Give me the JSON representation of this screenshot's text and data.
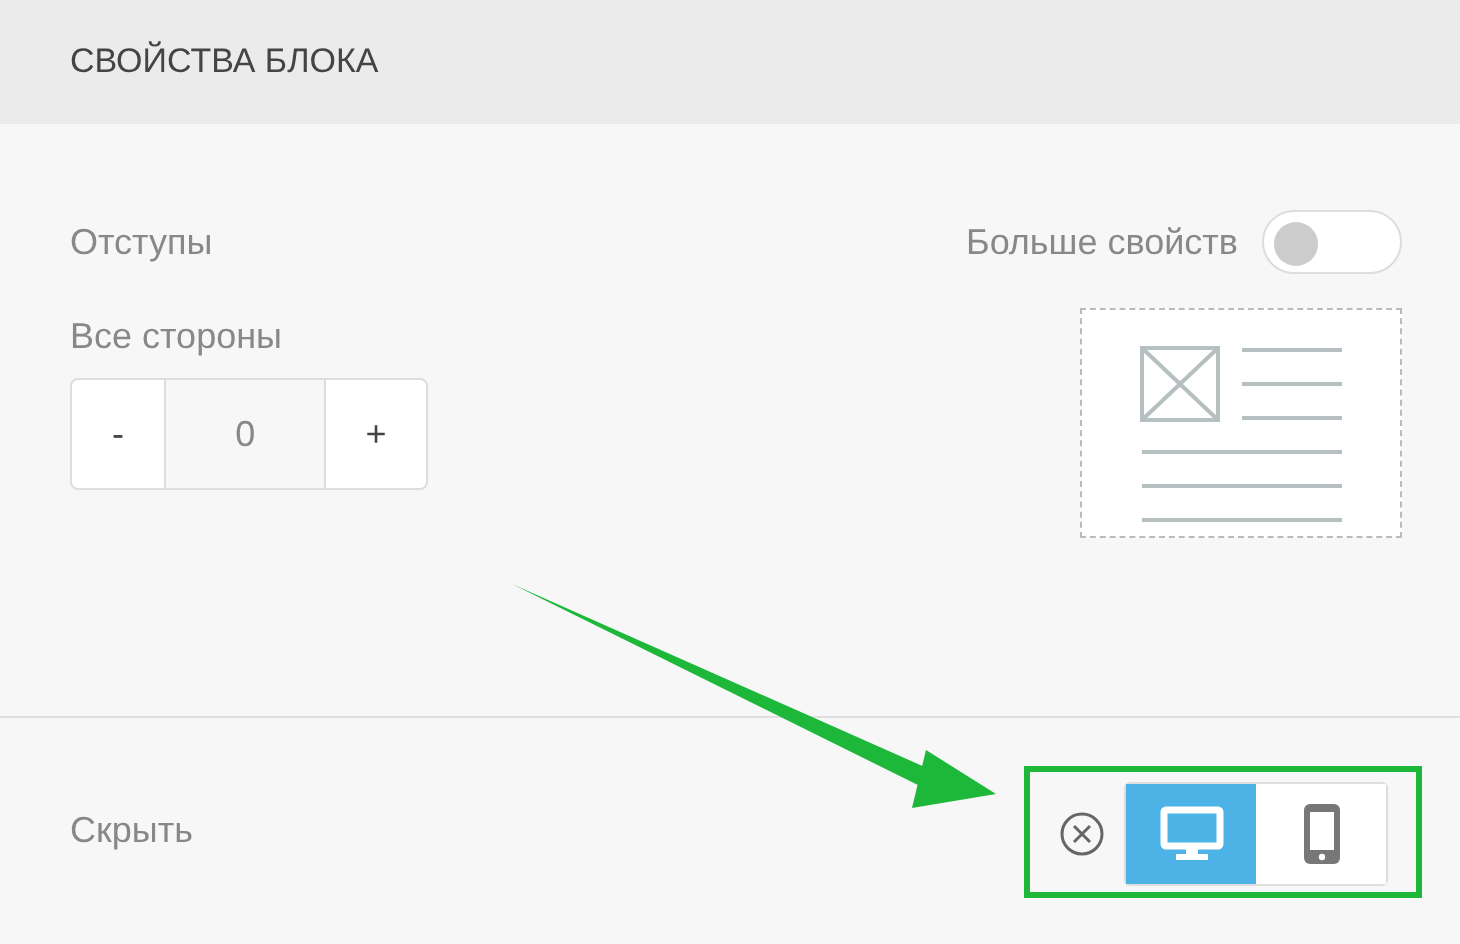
{
  "panel": {
    "title": "СВОЙСТВА БЛОКА"
  },
  "margins": {
    "label": "Отступы"
  },
  "more_properties": {
    "label": "Больше свойств",
    "on": false
  },
  "all_sides": {
    "label": "Все стороны",
    "minus": "-",
    "value": "0",
    "plus": "+"
  },
  "hide": {
    "label": "Скрыть",
    "devices": [
      {
        "kind": "desktop",
        "selected": true
      },
      {
        "kind": "mobile",
        "selected": false
      }
    ]
  }
}
